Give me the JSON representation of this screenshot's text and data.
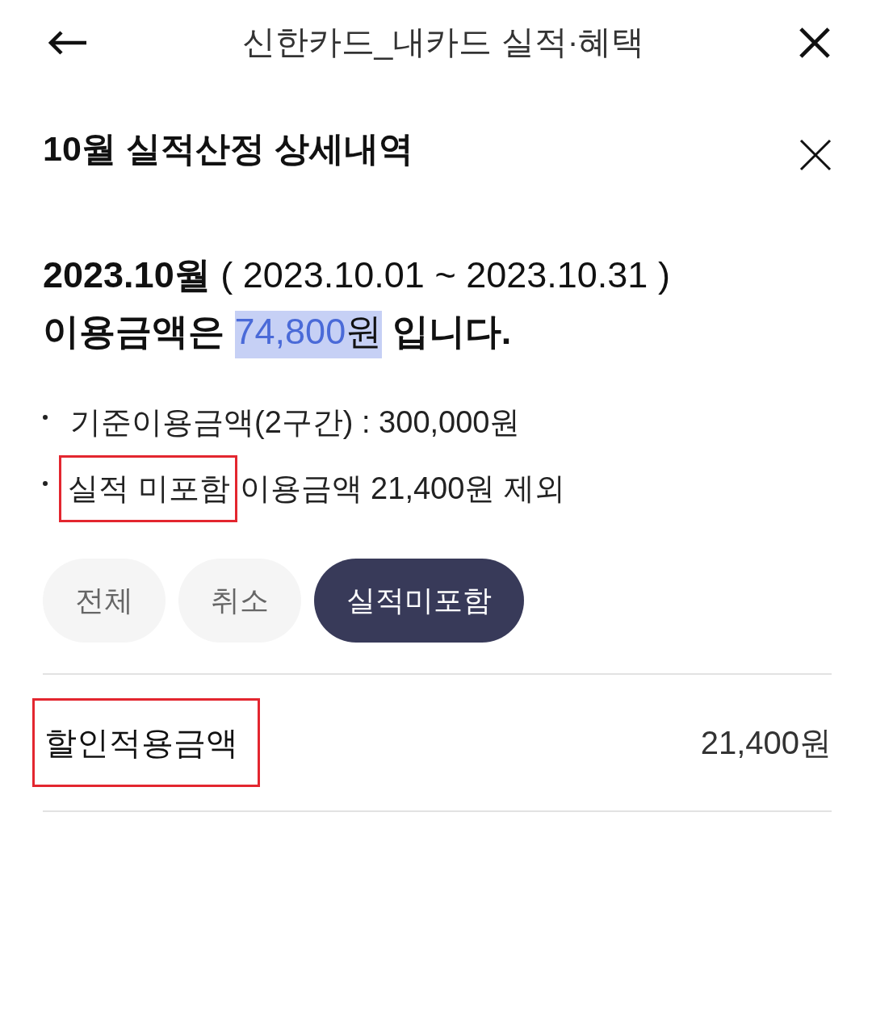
{
  "header": {
    "title": "신한카드_내카드 실적·혜택"
  },
  "panel": {
    "title": "10월 실적산정 상세내역"
  },
  "summary": {
    "period": "**2023.10월** ( 2023.10.01 ~ 2023.10.31 )",
    "usage": {
      "before": "이용금액은",
      "amount": "74,800",
      "unit": "원",
      "after": "입니다.",
      "highlighted": true
    }
  },
  "bullets": [
    {
      "parts": [
        {
          "text": "기준이용금액(2구간) : 300,000원",
          "boxed": false
        }
      ]
    },
    {
      "parts": [
        {
          "text": "실적 미포함",
          "boxed": true
        },
        {
          "text": "이용금액 21,400원 제외",
          "boxed": false
        }
      ]
    }
  ],
  "filters": [
    {
      "label": "전체",
      "selected": false
    },
    {
      "label": "취소",
      "selected": false
    },
    {
      "label": "실적미포함",
      "selected": true
    }
  ],
  "rows": [
    {
      "label": "할인적용금액",
      "amount": "21,400원",
      "boxed": true
    }
  ]
}
